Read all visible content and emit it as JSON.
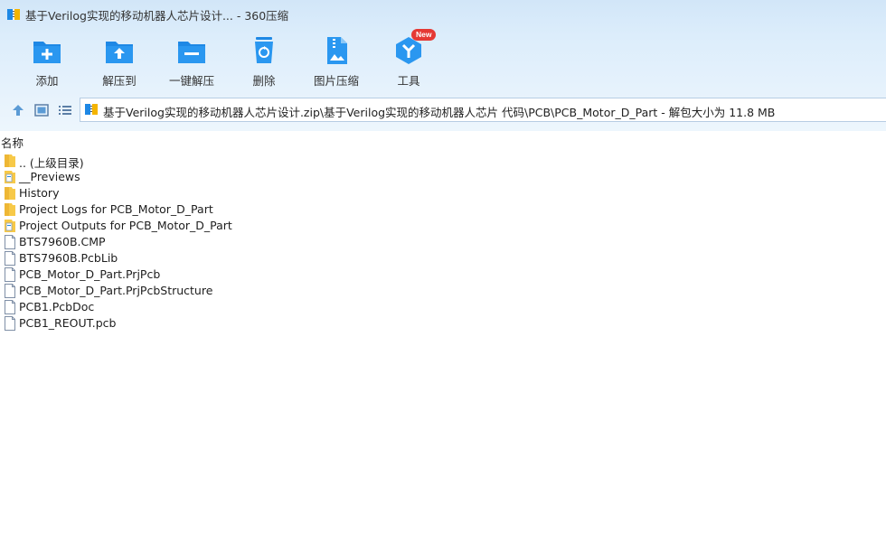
{
  "window": {
    "title": "基于Verilog实现的移动机器人芯片设计... - 360压缩"
  },
  "toolbar": {
    "buttons": [
      {
        "label": "添加",
        "icon": "add-icon"
      },
      {
        "label": "解压到",
        "icon": "extract-to-icon"
      },
      {
        "label": "一键解压",
        "icon": "one-click-extract-icon"
      },
      {
        "label": "删除",
        "icon": "delete-icon"
      },
      {
        "label": "图片压缩",
        "icon": "image-compress-icon"
      },
      {
        "label": "工具",
        "icon": "tools-icon",
        "badge": "New"
      }
    ]
  },
  "address": {
    "path": "基于Verilog实现的移动机器人芯片设计.zip\\基于Verilog实现的移动机器人芯片 代码\\PCB\\PCB_Motor_D_Part - 解包大小为 11.8 MB"
  },
  "list": {
    "column_name": "名称",
    "items": [
      {
        "name": ".. (上级目录)",
        "type": "folder"
      },
      {
        "name": "__Previews",
        "type": "folder-file"
      },
      {
        "name": "History",
        "type": "folder"
      },
      {
        "name": "Project Logs for PCB_Motor_D_Part",
        "type": "folder"
      },
      {
        "name": "Project Outputs for PCB_Motor_D_Part",
        "type": "folder-file"
      },
      {
        "name": "BTS7960B.CMP",
        "type": "file"
      },
      {
        "name": "BTS7960B.PcbLib",
        "type": "file"
      },
      {
        "name": "PCB_Motor_D_Part.PrjPcb",
        "type": "file"
      },
      {
        "name": "PCB_Motor_D_Part.PrjPcbStructure",
        "type": "file"
      },
      {
        "name": "PCB1.PcbDoc",
        "type": "file"
      },
      {
        "name": "PCB1_REOUT.pcb",
        "type": "file"
      }
    ]
  },
  "colors": {
    "accent": "#1e88e5",
    "folder": "#f7c948",
    "badge": "#e53935"
  }
}
